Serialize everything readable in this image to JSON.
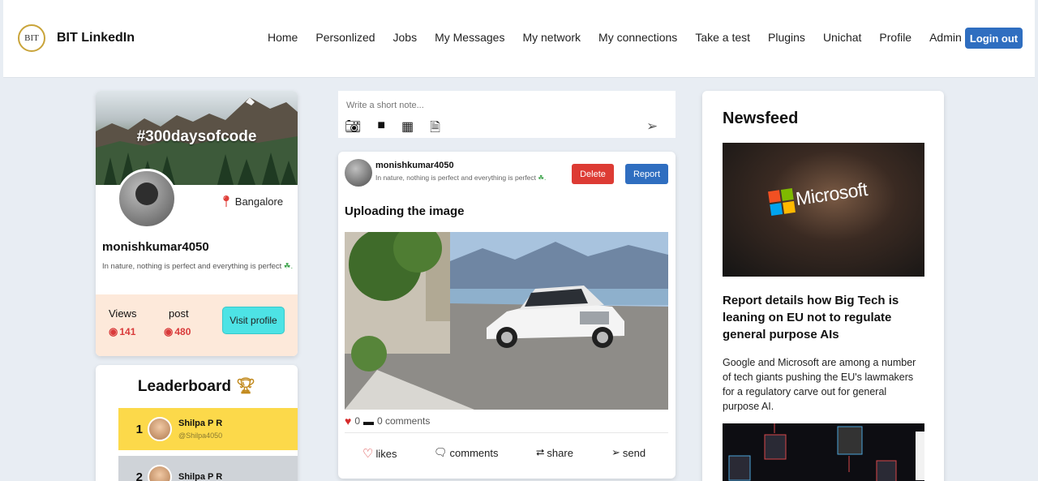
{
  "nav": {
    "logo_text": "BIT",
    "brand": "BIT LinkedIn",
    "links": [
      "Home",
      "Personlized",
      "Jobs",
      "My Messages",
      "My network",
      "My connections",
      "Take a test",
      "Plugins",
      "Unichat",
      "Profile",
      "Admin"
    ],
    "login_label": "Login out"
  },
  "profile": {
    "cover_text": "#300daysofcode",
    "location": "Bangalore",
    "username": "monishkumar4050",
    "bio": "In nature, nothing is perfect and everything is perfect",
    "views_label": "Views",
    "views_value": "141",
    "post_label": "post",
    "post_value": "480",
    "visit_label": "Visit profile"
  },
  "leaderboard": {
    "title": "Leaderboard",
    "rows": [
      {
        "rank": "1",
        "name": "Shilpa P R",
        "handle": "@Shilpa4050",
        "color": "#fcd94a"
      },
      {
        "rank": "2",
        "name": "Shilpa P R",
        "handle": "",
        "color": "#cfd3d8"
      }
    ]
  },
  "composer": {
    "placeholder": "Write a short note...",
    "icons": [
      "camera-icon",
      "video-icon",
      "calendar-icon",
      "document-icon",
      "send-icon"
    ]
  },
  "post": {
    "user": "monishkumar4050",
    "bio": "In nature, nothing is perfect and everything is perfect",
    "delete_label": "Delete",
    "report_label": "Report",
    "title": "Uploading the image",
    "likes_count": "0",
    "comments_count": "0 comments",
    "actions": {
      "likes": "likes",
      "comments": "comments",
      "share": "share",
      "send": "send"
    }
  },
  "newsfeed": {
    "title": "Newsfeed",
    "image1_text": "Microsoft",
    "headline": "Report details how Big Tech is leaning on EU not to regulate general purpose AIs",
    "body": "Google and Microsoft are among a number of tech giants pushing the EU's lawmakers for a regulatory carve out for general purpose AI."
  },
  "colors": {
    "primary": "#2f6ec0",
    "danger": "#dd3b34",
    "accent_cyan": "#4de3e5",
    "stats_bg": "#fde9da",
    "gold": "#fcd94a"
  }
}
